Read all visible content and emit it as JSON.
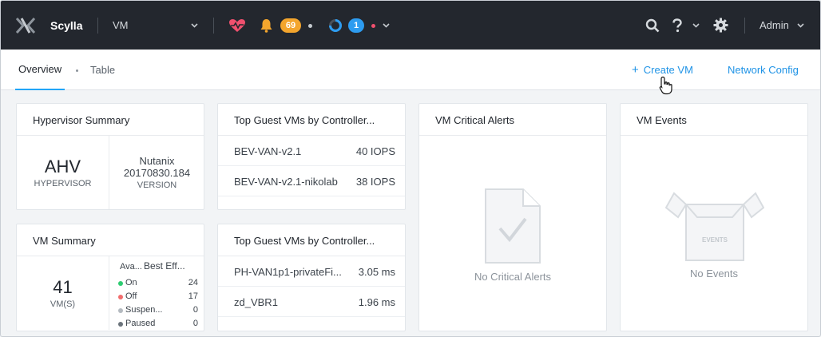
{
  "header": {
    "cluster_name": "Scylla",
    "entity_selector": "VM",
    "alerts_count": "69",
    "tasks_count": "1",
    "user": "Admin",
    "icons": [
      "nutanix-x-logo",
      "heart-pulse-icon",
      "bell-icon",
      "tasks-ring-icon",
      "search-icon",
      "help-icon",
      "gear-icon"
    ]
  },
  "nav": {
    "tabs": [
      "Overview",
      "Table"
    ],
    "active_tab": "Overview",
    "create_vm": "Create VM",
    "create_vm_symbol": "+",
    "network_config": "Network Config"
  },
  "hypervisor_summary": {
    "title": "Hypervisor Summary",
    "type": "AHV",
    "type_label": "HYPERVISOR",
    "vendor": "Nutanix",
    "version": "20170830.184",
    "version_label": "VERSION"
  },
  "top_vms_iops": {
    "title": "Top Guest VMs by Controller...",
    "rows": [
      {
        "name": "BEV-VAN-v2.1",
        "value": "40 IOPS"
      },
      {
        "name": "BEV-VAN-v2.1-nikolab",
        "value": "38 IOPS"
      }
    ]
  },
  "vm_summary": {
    "title": "VM Summary",
    "count": "41",
    "count_label": "VM(S)",
    "header_abbrev": "Ava...",
    "header_label": "Best Eff...",
    "states": [
      {
        "label": "On",
        "value": "24",
        "color": "#2ecc71"
      },
      {
        "label": "Off",
        "value": "17",
        "color": "#f26d6d"
      },
      {
        "label": "Suspen...",
        "value": "0",
        "color": "#b4bac0"
      },
      {
        "label": "Paused",
        "value": "0",
        "color": "#6b737b"
      }
    ]
  },
  "top_vms_latency": {
    "title": "Top Guest VMs by Controller...",
    "rows": [
      {
        "name": "PH-VAN1p1-privateFi...",
        "value": "3.05 ms"
      },
      {
        "name": "zd_VBR1",
        "value": "1.96 ms"
      }
    ]
  },
  "critical_alerts": {
    "title": "VM Critical Alerts",
    "empty_text": "No Critical Alerts"
  },
  "vm_events": {
    "title": "VM Events",
    "box_label": "EVENTS",
    "empty_text": "No Events"
  },
  "colors": {
    "accent": "#22a5f7",
    "link": "#1f93e6",
    "header_bg": "#23272e",
    "alerts_badge": "#f3a52d",
    "tasks_badge": "#2d9cf0",
    "health_icon": "#f0506e"
  }
}
